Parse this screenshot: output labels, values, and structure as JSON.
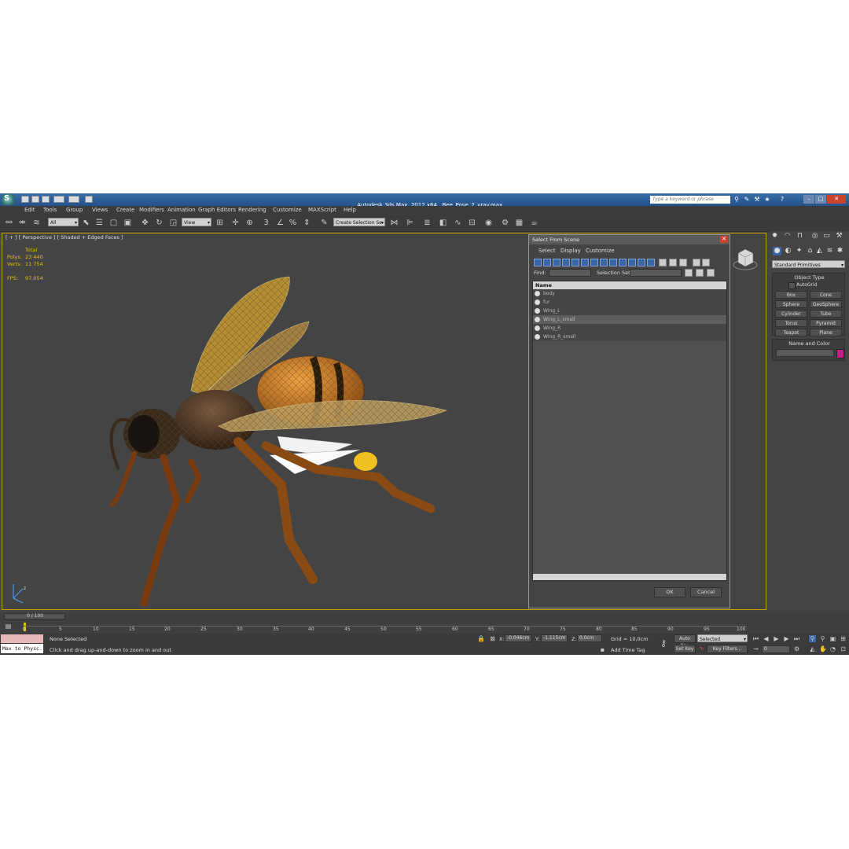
{
  "window": {
    "app_title": "Autodesk 3ds Max  2012 x64",
    "file_name": "Bee_Pose_2_vray.max",
    "search_placeholder": "Type a keyword or phrase"
  },
  "menubar": [
    "Edit",
    "Tools",
    "Group",
    "Views",
    "Create",
    "Modifiers",
    "Animation",
    "Graph Editors",
    "Rendering",
    "Customize",
    "MAXScript",
    "Help"
  ],
  "toolbar": {
    "filter_value": "All",
    "coord_value": "View",
    "selection_set": "Create Selection Se"
  },
  "viewport": {
    "label": "[ + ] [ Perspective ] [ Shaded + Edged Faces ]",
    "stats": {
      "total_label": "Total",
      "polys_label": "Polys:",
      "polys_value": "23 440",
      "verts_label": "Verts:",
      "verts_value": "11 754",
      "fps_label": "FPS:",
      "fps_value": "97,054"
    }
  },
  "command_panel": {
    "category": "Standard Primitives",
    "object_type_title": "Object Type",
    "autogrid_label": "AutoGrid",
    "buttons": [
      "Box",
      "Cone",
      "Sphere",
      "GeoSphere",
      "Cylinder",
      "Tube",
      "Torus",
      "Pyramid",
      "Teapot",
      "Plane"
    ],
    "name_color_title": "Name and Color",
    "color": "#c41e8a"
  },
  "dialog": {
    "title": "Select From Scene",
    "menu": [
      "Select",
      "Display",
      "Customize"
    ],
    "find_label": "Find:",
    "selection_set_label": "Selection Set:",
    "column_name": "Name",
    "items": [
      "body",
      "fur",
      "Wing_L",
      "Wing_L_small",
      "Wing_R",
      "Wing_R_small"
    ],
    "ok_label": "OK",
    "cancel_label": "Cancel"
  },
  "timeline": {
    "frame_counter": "0 / 100",
    "ticks": [
      "0",
      "5",
      "10",
      "15",
      "20",
      "25",
      "30",
      "35",
      "40",
      "45",
      "50",
      "55",
      "60",
      "65",
      "70",
      "75",
      "80",
      "85",
      "90",
      "95",
      "100"
    ]
  },
  "statusbar": {
    "maxscript_listener": "Max to Physc.",
    "selection_status": "None Selected",
    "prompt": "Click and drag up-and-down to zoom in and out",
    "x_label": "X:",
    "x_value": "-0,046cm",
    "y_label": "Y:",
    "y_value": "-1,115cm",
    "z_label": "Z:",
    "z_value": "0,0cm",
    "grid": "Grid = 10,0cm",
    "add_time_tag": "Add Time Tag",
    "auto_key": "Auto Key",
    "set_key": "Set Key",
    "key_mode_value": "Selected",
    "key_filters": "Key Filters...",
    "current_frame": "0"
  }
}
